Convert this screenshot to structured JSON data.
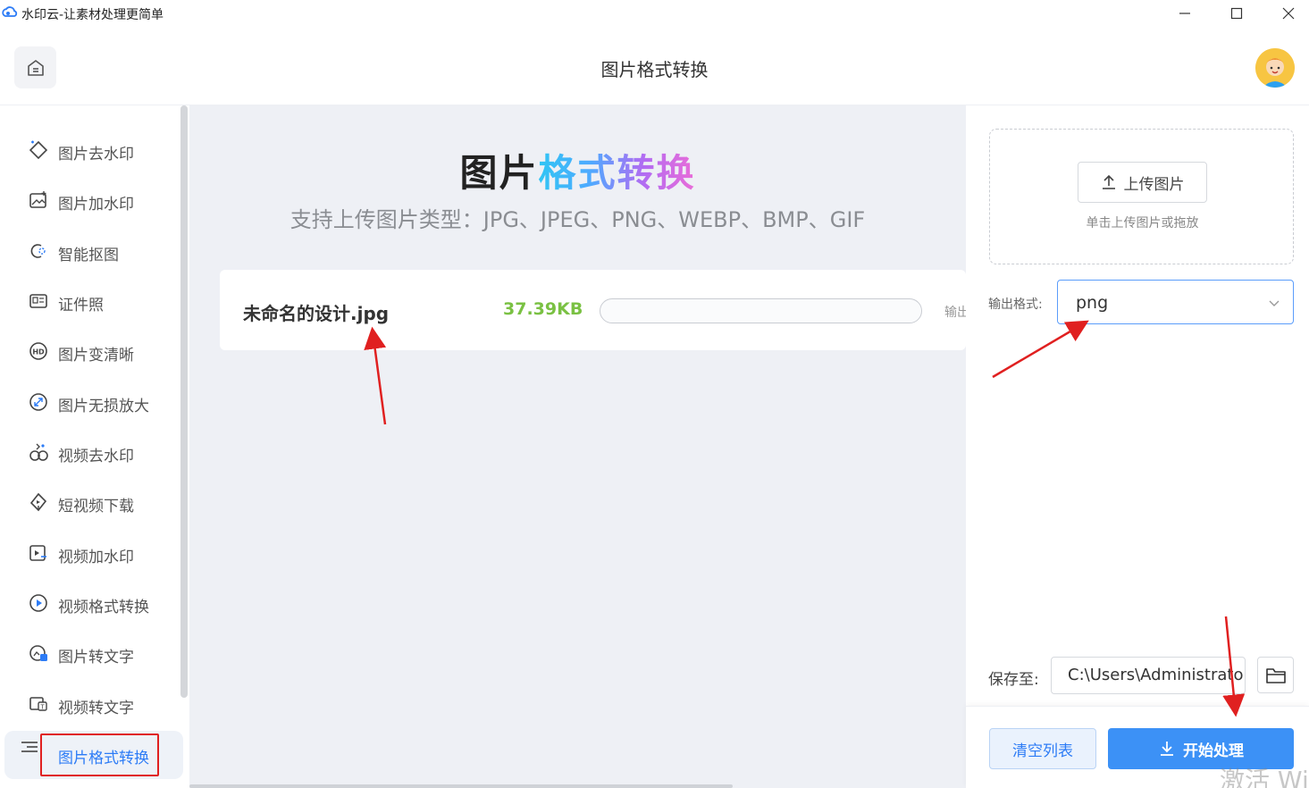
{
  "window": {
    "title": "水印云-让素材处理更简单",
    "min_glyph": "—",
    "max_glyph": "☐",
    "close_glyph": "✕"
  },
  "header": {
    "title": "图片格式转换"
  },
  "sidebar": {
    "items": [
      {
        "label": "图片去水印",
        "icon": "eraser-icon"
      },
      {
        "label": "图片加水印",
        "icon": "image-add-icon"
      },
      {
        "label": "智能抠图",
        "icon": "cutout-icon"
      },
      {
        "label": "证件照",
        "icon": "id-card-icon"
      },
      {
        "label": "图片变清晰",
        "icon": "hd-icon"
      },
      {
        "label": "图片无损放大",
        "icon": "enlarge-icon"
      },
      {
        "label": "视频去水印",
        "icon": "video-eraser-icon"
      },
      {
        "label": "短视频下载",
        "icon": "video-download-icon"
      },
      {
        "label": "视频加水印",
        "icon": "video-add-icon"
      },
      {
        "label": "视频格式转换",
        "icon": "play-circle-icon"
      },
      {
        "label": "图片转文字",
        "icon": "image-text-icon"
      },
      {
        "label": "视频转文字",
        "icon": "video-text-icon"
      },
      {
        "label": "图片格式转换",
        "icon": "menu-icon",
        "active": true
      }
    ]
  },
  "main": {
    "title_part1": "图片",
    "title_part2": "格式转换",
    "subtitle": "支持上传图片类型：JPG、JPEG、PNG、WEBP、BMP、GIF",
    "file": {
      "name": "未命名的设计.jpg",
      "size": "37.39KB",
      "progress": 0,
      "output_label": "输出"
    }
  },
  "right": {
    "upload_label": "上传图片",
    "upload_hint": "单击上传图片或拖放",
    "format_label": "输出格式:",
    "format_value": "png",
    "save_label": "保存至:",
    "save_path": "C:\\Users\\Administrator",
    "clear_label": "清空列表",
    "start_label": "开始处理"
  },
  "watermark": "激活 Win",
  "colors": {
    "accent": "#3c91f6",
    "size_green": "#7ac143",
    "annotation_red": "#e02020"
  }
}
